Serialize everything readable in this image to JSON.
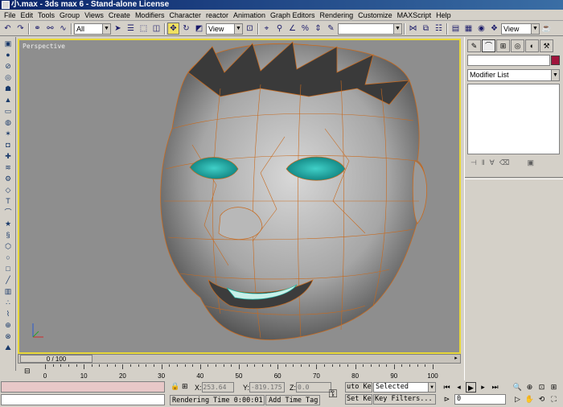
{
  "window": {
    "title": "小.max - 3ds max 6 - Stand-alone License"
  },
  "menu": {
    "items": [
      "File",
      "Edit",
      "Tools",
      "Group",
      "Views",
      "Create",
      "Modifiers",
      "Character",
      "reactor",
      "Animation",
      "Graph Editors",
      "Rendering",
      "Customize",
      "MAXScript",
      "Help"
    ]
  },
  "toolbar": {
    "selection_filter": "All",
    "reference_coord": "View",
    "named_selection": "",
    "render_type": "View"
  },
  "viewport": {
    "label": "Perspective",
    "background_color": "#8e8e8e",
    "border_color": "#e8d838",
    "wire_color": "#c86a1e",
    "eye_color": "#18a8a0"
  },
  "timeline": {
    "slider_label": "0 / 100",
    "ruler_labels": [
      "0",
      "10",
      "20",
      "30",
      "40",
      "50",
      "60",
      "70",
      "80",
      "90",
      "100"
    ]
  },
  "command_panel": {
    "object_name": "",
    "object_color": "#a0143c",
    "modifier_list": "Modifier List"
  },
  "status": {
    "x_label": "X:",
    "x_value": "253.64",
    "y_label": "Y:",
    "y_value": "-819.175",
    "z_label": "Z:",
    "z_value": "0.0",
    "render_time": "Rendering Time  0:00:01",
    "add_time_tag": "Add Time Tag",
    "auto_key": "uto Key",
    "set_key": "Set Key",
    "key_mode": "Selected",
    "key_filters": "Key Filters...",
    "current_frame": "0"
  }
}
